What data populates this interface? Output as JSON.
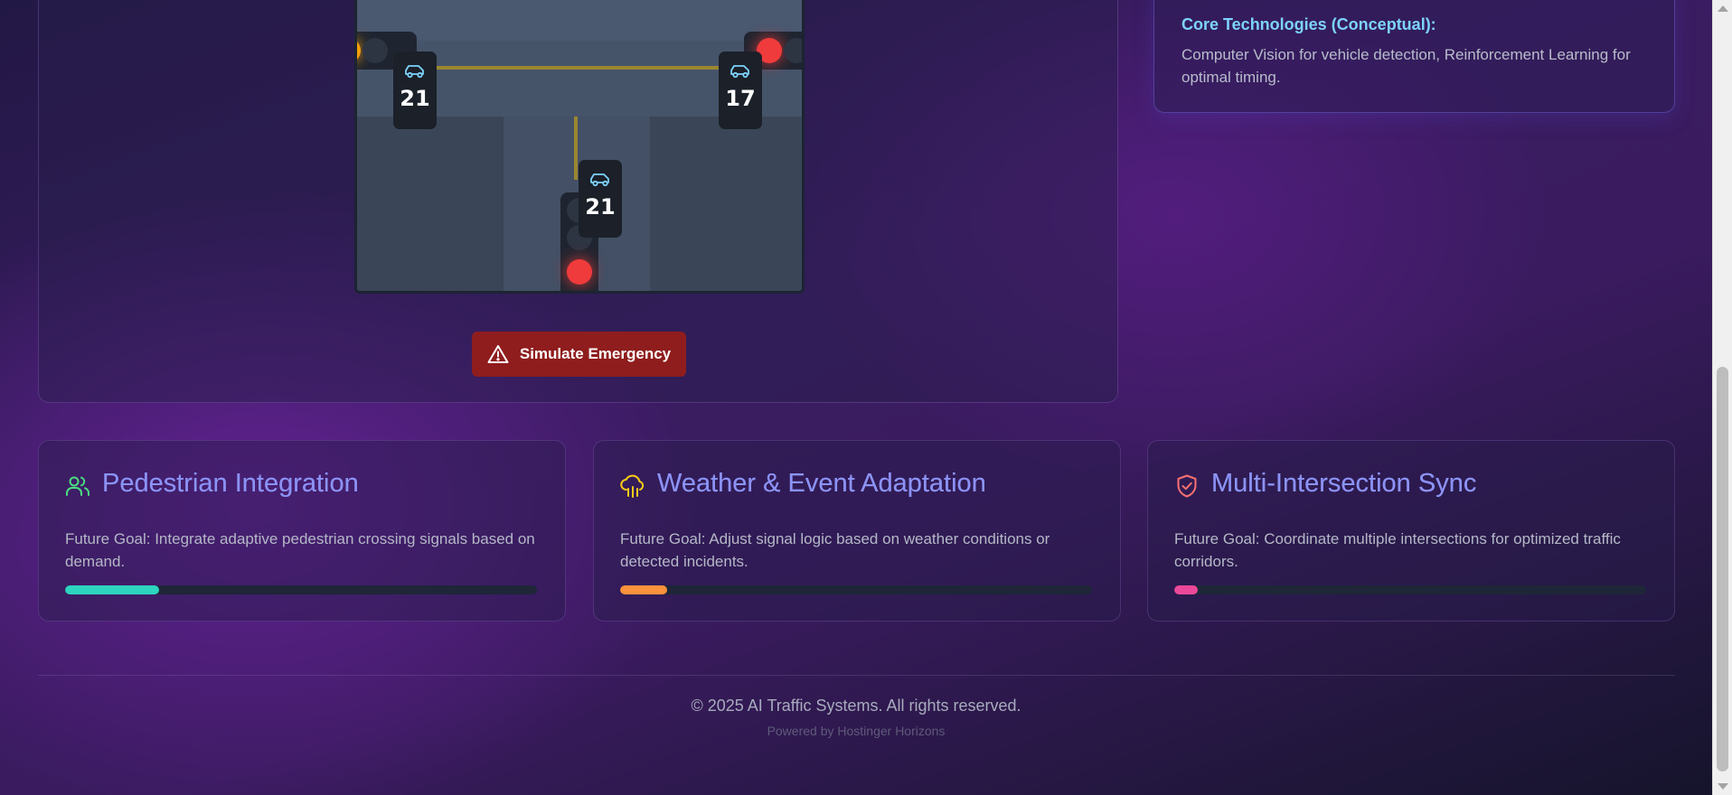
{
  "simulation": {
    "counters": [
      {
        "id": "west",
        "value": "21"
      },
      {
        "id": "east",
        "value": "17"
      },
      {
        "id": "south",
        "value": "21"
      }
    ],
    "emergency_button": {
      "label": "Simulate Emergency",
      "icon": "warning-triangle-icon"
    }
  },
  "info_card": {
    "title": "Core Technologies (Conceptual):",
    "text": "Computer Vision for vehicle detection, Reinforcement Learning for optimal timing."
  },
  "features": [
    {
      "title": "Pedestrian Integration",
      "icon": "users-icon",
      "description": "Future Goal: Integrate adaptive pedestrian crossing signals based on demand.",
      "progress": 0.2,
      "color": "#2dd4bf"
    },
    {
      "title": "Weather & Event Adaptation",
      "icon": "cloud-rain-icon",
      "description": "Future Goal: Adjust signal logic based on weather conditions or detected incidents.",
      "progress": 0.1,
      "color": "#fb923c"
    },
    {
      "title": "Multi-Intersection Sync",
      "icon": "shield-check-icon",
      "description": "Future Goal: Coordinate multiple intersections for optimized traffic corridors.",
      "progress": 0.05,
      "color": "#ec4899"
    }
  ],
  "footer": {
    "copyright": "© 2025 AI Traffic Systems. All rights reserved.",
    "powered_by": "Powered by Hostinger Horizons"
  }
}
